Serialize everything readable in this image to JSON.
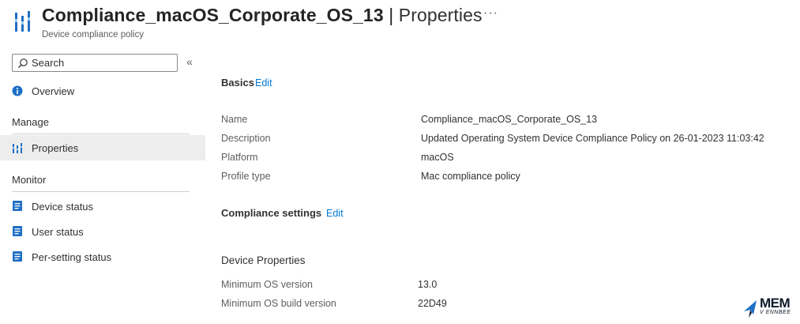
{
  "header": {
    "title_name": "Compliance_macOS_Corporate_OS_13",
    "title_separator": "|",
    "title_page": "Properties",
    "more_label": "···",
    "subtitle": "Device compliance policy",
    "icon": "policy-bars-icon"
  },
  "sidebar": {
    "search_placeholder": "Search",
    "collapse_label": "«",
    "overview_label": "Overview",
    "manage_header": "Manage",
    "properties_label": "Properties",
    "monitor_header": "Monitor",
    "monitor_items": [
      {
        "label": "Device status",
        "icon": "report-icon"
      },
      {
        "label": "User status",
        "icon": "report-icon"
      },
      {
        "label": "Per-setting status",
        "icon": "report-icon"
      }
    ]
  },
  "main": {
    "basics": {
      "title": "Basics",
      "edit_label": "Edit",
      "rows": [
        {
          "label": "Name",
          "value": "Compliance_macOS_Corporate_OS_13"
        },
        {
          "label": "Description",
          "value": "Updated Operating System Device Compliance Policy on 26-01-2023 11:03:42"
        },
        {
          "label": "Platform",
          "value": "macOS"
        },
        {
          "label": "Profile type",
          "value": "Mac compliance policy"
        }
      ]
    },
    "compliance_settings": {
      "title": "Compliance settings",
      "edit_label": "Edit"
    },
    "device_properties": {
      "title": "Device Properties",
      "rows": [
        {
          "label": "Minimum OS version",
          "value": "13.0"
        },
        {
          "label": "Minimum OS build version",
          "value": "22D49"
        }
      ]
    }
  },
  "watermark": {
    "text": "MEM",
    "subtext": "V ENNBEE"
  },
  "colors": {
    "accent": "#0078d4",
    "active_nav_bg": "#ededed",
    "text": "#323130",
    "muted": "#605e5c"
  }
}
